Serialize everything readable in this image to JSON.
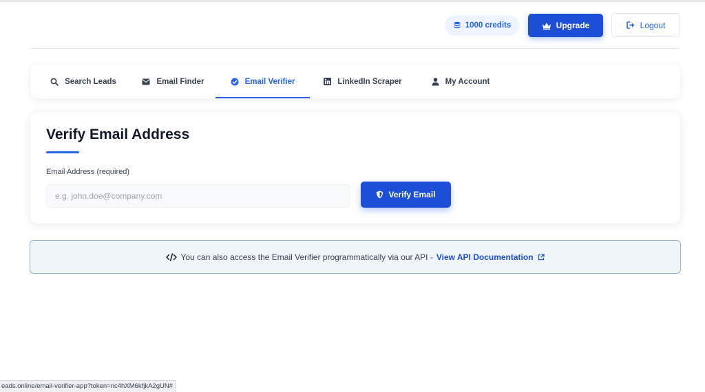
{
  "header": {
    "credits_label": "1000 credits",
    "upgrade_label": "Upgrade",
    "logout_label": "Logout"
  },
  "tabs": [
    {
      "label": "Search Leads",
      "icon": "search-icon",
      "active": false
    },
    {
      "label": "Email Finder",
      "icon": "envelope-icon",
      "active": false
    },
    {
      "label": "Email Verifier",
      "icon": "check-circle-icon",
      "active": true
    },
    {
      "label": "LinkedIn Scraper",
      "icon": "linkedin-icon",
      "active": false
    },
    {
      "label": "My Account",
      "icon": "user-icon",
      "active": false
    }
  ],
  "verify": {
    "title": "Verify Email Address",
    "field_label": "Email Address (required)",
    "input_value": "",
    "input_placeholder": "e.g. john.doe@company.com",
    "button_label": "Verify Email"
  },
  "api_banner": {
    "text": "You can also access the Email Verifier programmatically via our API -",
    "link_label": "View API Documentation"
  },
  "status_bar": {
    "url": "eads.online/email-verifier-app?token=nc4hXM6kfjkA2gUN#"
  },
  "colors": {
    "accent": "#2563eb",
    "button": "#1d4ed8",
    "banner_bg": "#f0f5fa",
    "banner_border": "#93b4dc"
  }
}
